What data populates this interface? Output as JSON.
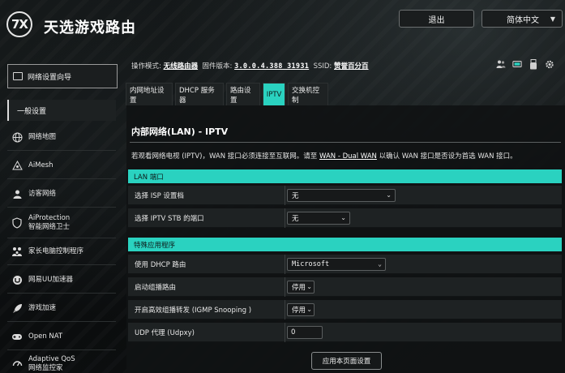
{
  "header": {
    "brand": "天选游戏路由",
    "logo_text": "7X",
    "logout_label": "退出",
    "language_label": "简体中文"
  },
  "status": {
    "mode_label": "操作模式:",
    "mode_value": "无线路由器",
    "firmware_label": "固件版本:",
    "firmware_value": "3.0.0.4.388_31931",
    "ssid_label": "SSID:",
    "ssid_value": "赞誉百分百",
    "icons": [
      "users-icon",
      "network-icon",
      "usb-icon",
      "gear-icon"
    ]
  },
  "sidebar": {
    "qis_label": "网络设置向导",
    "section_label": "一般设置",
    "items": [
      {
        "label": "网络地图",
        "icon": "globe-icon"
      },
      {
        "label": "AiMesh",
        "icon": "mesh-icon"
      },
      {
        "label": "访客网络",
        "icon": "guest-icon"
      },
      {
        "label": "AiProtection",
        "label2": "智能网络卫士",
        "icon": "shield-icon"
      },
      {
        "label": "家长电脑控制程序",
        "icon": "family-icon"
      },
      {
        "label": "网易UU加速器",
        "icon": "uu-icon"
      },
      {
        "label": "游戏加速",
        "icon": "rocket-icon"
      },
      {
        "label": "Open NAT",
        "icon": "gamepad-icon"
      },
      {
        "label": "Adaptive QoS",
        "label2": "网络监控家",
        "icon": "qos-icon"
      }
    ]
  },
  "tabs": [
    {
      "label": "内网地址设置",
      "active": false
    },
    {
      "label": "DHCP 服务器",
      "active": false
    },
    {
      "label": "路由设置",
      "active": false
    },
    {
      "label": "IPTV",
      "active": true
    },
    {
      "label": "交换机控制",
      "active": false
    }
  ],
  "main": {
    "title": "内部网络(LAN) - IPTV",
    "description_pre": "若观看网络电视 (IPTV)，WAN 接口必须连接至互联网。请至 ",
    "description_link": "WAN - Dual WAN",
    "description_post": " 以确认 WAN 接口是否设为首选 WAN 接口。",
    "lan_port": {
      "heading": "LAN 端口",
      "rows": [
        {
          "label": "选择 ISP 设置档",
          "value": "无"
        },
        {
          "label": "选择 IPTV STB 的端口",
          "value": "无"
        }
      ]
    },
    "special_apps": {
      "heading": "特殊应用程序",
      "rows": [
        {
          "label": "使用 DHCP 路由",
          "value": "Microsoft"
        },
        {
          "label": "启动组播路由",
          "value": "停用"
        },
        {
          "label": "开启高效组播转发 (IGMP Snooping )",
          "value": "停用"
        },
        {
          "label": "UDP 代理 (Udpxy)",
          "value": "0"
        }
      ]
    },
    "apply_label": "应用本页面设置"
  }
}
